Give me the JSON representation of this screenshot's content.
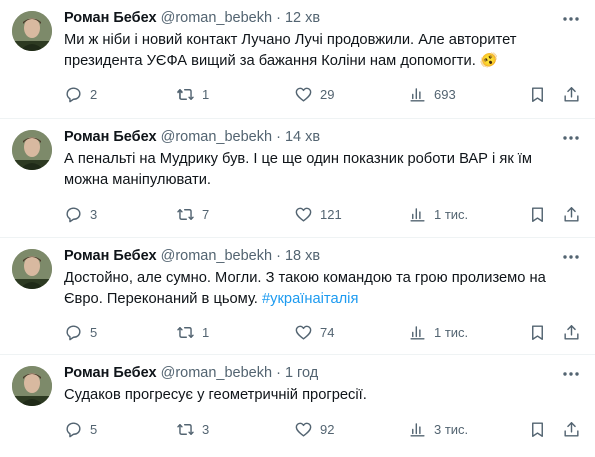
{
  "tweets": [
    {
      "name": "Роман Бебех",
      "handle": "@roman_bebekh",
      "separator": "·",
      "time": "12 хв",
      "text": "Ми ж ніби і новий контакт Лучано Лучі продовжили. Але авторитет президента УЄФА вищий за бажання Коліни нам допомогти.",
      "emoji": "🫨",
      "hashtag": "",
      "replies": "2",
      "reposts": "1",
      "likes": "29",
      "views": "693"
    },
    {
      "name": "Роман Бебех",
      "handle": "@roman_bebekh",
      "separator": "·",
      "time": "14 хв",
      "text": "А пенальті на Мудрику був. І це ще один показник роботи ВАР і як їм можна маніпулювати.",
      "emoji": "",
      "hashtag": "",
      "replies": "3",
      "reposts": "7",
      "likes": "121",
      "views": "1 тис."
    },
    {
      "name": "Роман Бебех",
      "handle": "@roman_bebekh",
      "separator": "·",
      "time": "18 хв",
      "text": "Достойно, але сумно. Могли. З такою командою та грою пролиземо на Євро. Переконаний в цьому. ",
      "emoji": "",
      "hashtag": "#українаіталія",
      "replies": "5",
      "reposts": "1",
      "likes": "74",
      "views": "1 тис."
    },
    {
      "name": "Роман Бебех",
      "handle": "@roman_bebekh",
      "separator": "·",
      "time": "1 год",
      "text": "Судаков прогресує у геометричній прогресії.",
      "emoji": "",
      "hashtag": "",
      "replies": "5",
      "reposts": "3",
      "likes": "92",
      "views": "3 тис."
    }
  ],
  "icons": {
    "reply": "reply-icon",
    "repost": "repost-icon",
    "like": "heart-icon",
    "views": "views-chart-icon",
    "bookmark": "bookmark-icon",
    "share": "share-icon",
    "more": "more-dots-icon"
  },
  "colors": {
    "text": "#0f1419",
    "muted": "#536471",
    "hashtag": "#1d9bf0",
    "divider": "#eff3f4"
  }
}
